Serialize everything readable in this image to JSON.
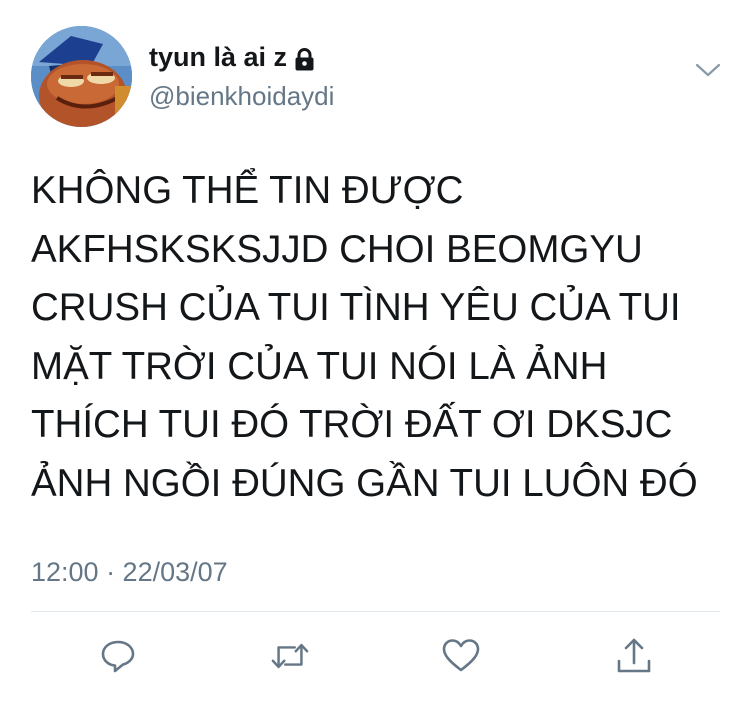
{
  "user": {
    "display_name": "tyun là ai z",
    "handle": "@bienkhoidaydi",
    "protected_icon": "lock-icon"
  },
  "tweet": {
    "text": "KHÔNG THỂ TIN ĐƯỢC\nAKFHSKSKSJJD CHOI BEOMGYU\nCRUSH CỦA TUI TÌNH YÊU CỦA TUI\nMẶT TRỜI CỦA TUI NÓI LÀ ẢNH\nTHÍCH TUI ĐÓ TRỜI ĐẤT ƠI DKSJC\nẢNH NGỒI ĐÚNG GẦN TUI LUÔN ĐÓ",
    "timestamp": "12:00 · 22/03/07"
  },
  "actions": [
    {
      "name": "reply",
      "icon": "reply-icon"
    },
    {
      "name": "retweet",
      "icon": "retweet-icon"
    },
    {
      "name": "like",
      "icon": "heart-icon"
    },
    {
      "name": "share",
      "icon": "share-icon"
    }
  ],
  "colors": {
    "text": "#14171a",
    "secondary": "#657786",
    "divider": "#e1e8ed",
    "icon": "#657786"
  }
}
